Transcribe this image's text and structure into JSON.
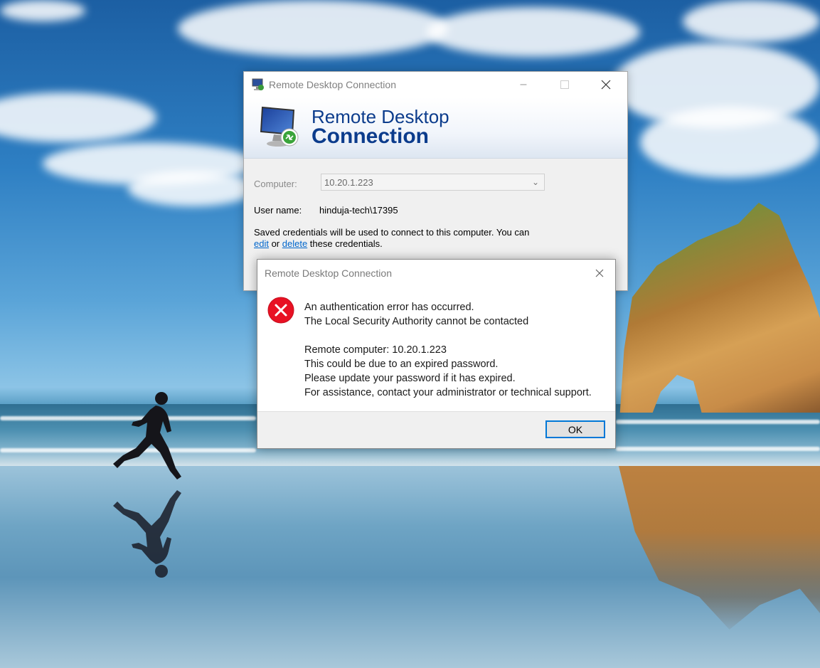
{
  "main_window": {
    "title": "Remote Desktop Connection",
    "banner_line1": "Remote Desktop",
    "banner_line2": "Connection",
    "computer_label": "Computer:",
    "computer_value": "10.20.1.223",
    "username_label": "User name:",
    "username_value": "hinduja-tech\\17395",
    "saved_text_part1": "Saved credentials will be used to connect to this computer.  You can ",
    "edit_link": "edit",
    "saved_text_or": " or ",
    "delete_link": "delete",
    "saved_text_part2": " these credentials."
  },
  "error_dialog": {
    "title": "Remote Desktop Connection",
    "message_lines": [
      "An authentication error has occurred.",
      "The Local Security Authority cannot be contacted",
      "Remote computer: 10.20.1.223",
      "This could be due to an expired password.",
      "Please update your password if it has expired.",
      "For assistance, contact your administrator or technical support."
    ],
    "ok_label": "OK"
  },
  "icons": {
    "window_minimize": "minimize-icon",
    "window_maximize": "maximize-icon",
    "window_close": "close-icon",
    "error": "error-icon",
    "app": "remote-desktop-icon"
  },
  "colors": {
    "accent": "#0078d7",
    "banner_text": "#0c3c8c",
    "link": "#0066cc",
    "error_red": "#e81123"
  }
}
